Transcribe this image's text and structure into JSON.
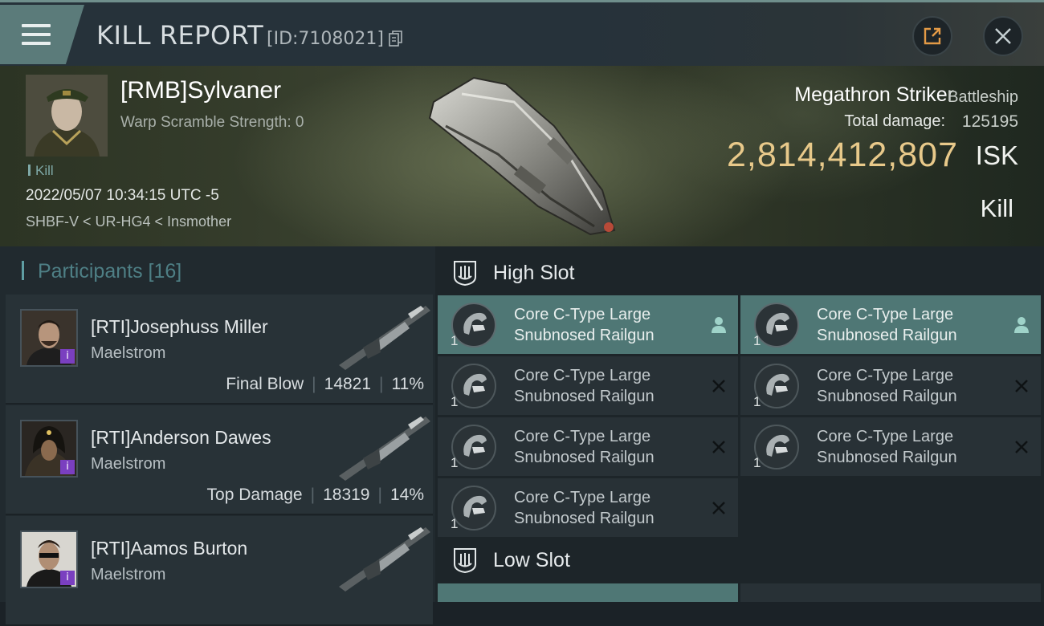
{
  "header": {
    "title": "KILL REPORT",
    "report_id": "[ID:7108021]",
    "icons": {
      "menu": "hamburger-menu-icon",
      "copy": "copy-icon",
      "share": "share-icon",
      "close": "close-icon"
    }
  },
  "victim": {
    "name": "[RMB]Sylvaner",
    "warp_scramble": "Warp Scramble Strength: 0",
    "tag": "Kill",
    "datetime": "2022/05/07 10:34:15 UTC -5",
    "location": "SHBF-V < UR-HG4 < Insmother"
  },
  "ship": {
    "name": "Megathron Striker",
    "class": "Battleship",
    "damage_label": "Total damage:",
    "damage_value": "125195",
    "isk_value": "2,814,412,807",
    "isk_unit": "ISK",
    "result": "Kill"
  },
  "participants": {
    "title": "Participants",
    "count": "[16]",
    "list": [
      {
        "name": "[RTI]Josephuss Miller",
        "ship": "Maelstrom",
        "role": "Final Blow",
        "damage": "14821",
        "percent": "11%"
      },
      {
        "name": "[RTI]Anderson Dawes",
        "ship": "Maelstrom",
        "role": "Top Damage",
        "damage": "18319",
        "percent": "14%"
      },
      {
        "name": "[RTI]Aamos Burton",
        "ship": "Maelstrom",
        "role": "",
        "damage": "",
        "percent": ""
      }
    ]
  },
  "slots": {
    "high": {
      "title": "High Slot",
      "modules": [
        {
          "line1": "Core C-Type Large",
          "line2": "Snubnosed Railgun",
          "qty": "1",
          "status": "person-icon",
          "active": true
        },
        {
          "line1": "Core C-Type Large",
          "line2": "Snubnosed Railgun",
          "qty": "1",
          "status": "person-icon",
          "active": true
        },
        {
          "line1": "Core C-Type Large",
          "line2": "Snubnosed Railgun",
          "qty": "1",
          "status": "destroyed-x-icon",
          "active": false
        },
        {
          "line1": "Core C-Type Large",
          "line2": "Snubnosed Railgun",
          "qty": "1",
          "status": "destroyed-x-icon",
          "active": false
        },
        {
          "line1": "Core C-Type Large",
          "line2": "Snubnosed Railgun",
          "qty": "1",
          "status": "destroyed-x-icon",
          "active": false
        },
        {
          "line1": "Core C-Type Large",
          "line2": "Snubnosed Railgun",
          "qty": "1",
          "status": "destroyed-x-icon",
          "active": false
        },
        {
          "line1": "Core C-Type Large",
          "line2": "Snubnosed Railgun",
          "qty": "1",
          "status": "destroyed-x-icon",
          "active": false
        }
      ]
    },
    "low": {
      "title": "Low Slot"
    }
  },
  "colors": {
    "accent_teal": "#4f7775",
    "isk_gold": "#e8c98a",
    "badge_purple": "#7a3fc0"
  }
}
